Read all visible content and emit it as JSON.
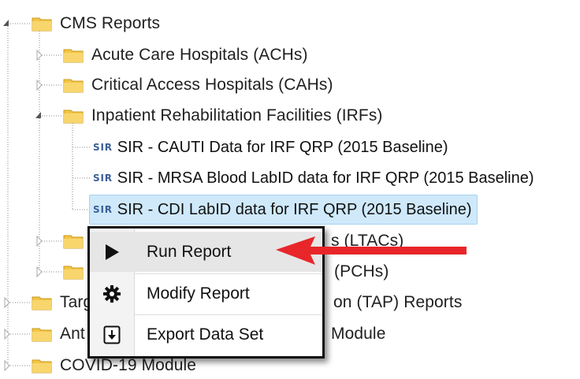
{
  "tree": {
    "cms_reports": "CMS Reports",
    "achs": "Acute Care Hospitals (ACHs)",
    "cahs": "Critical Access Hospitals (CAHs)",
    "irfs": "Inpatient Rehabilitation Facilities (IRFs)",
    "ltacs_partial": "s (LTACs)",
    "pchs_partial": "(PCHs)",
    "tap_partial_start": "Targ",
    "tap_partial_end": "on (TAP) Reports",
    "ant_partial_start": "Ant",
    "ant_partial_end": "Module",
    "covid": "COVID-19 Module",
    "sir_badge": "SIR",
    "reports": [
      {
        "label": "SIR - CAUTI Data for IRF QRP (2015 Baseline)",
        "selected": false
      },
      {
        "label": "SIR - MRSA Blood LabID data for IRF QRP (2015 Baseline)",
        "selected": false
      },
      {
        "label": "SIR - CDI LabID data for IRF QRP (2015 Baseline)",
        "selected": true
      }
    ]
  },
  "context_menu": {
    "items": [
      {
        "label": "Run Report",
        "icon": "play-icon"
      },
      {
        "label": "Modify Report",
        "icon": "gear-icon"
      },
      {
        "label": "Export Data Set",
        "icon": "export-icon"
      }
    ]
  },
  "colors": {
    "selection": "#cfe9fb",
    "folder": "#f3c546",
    "arrow": "#e8262a",
    "sir_badge": "#3a5f97"
  }
}
